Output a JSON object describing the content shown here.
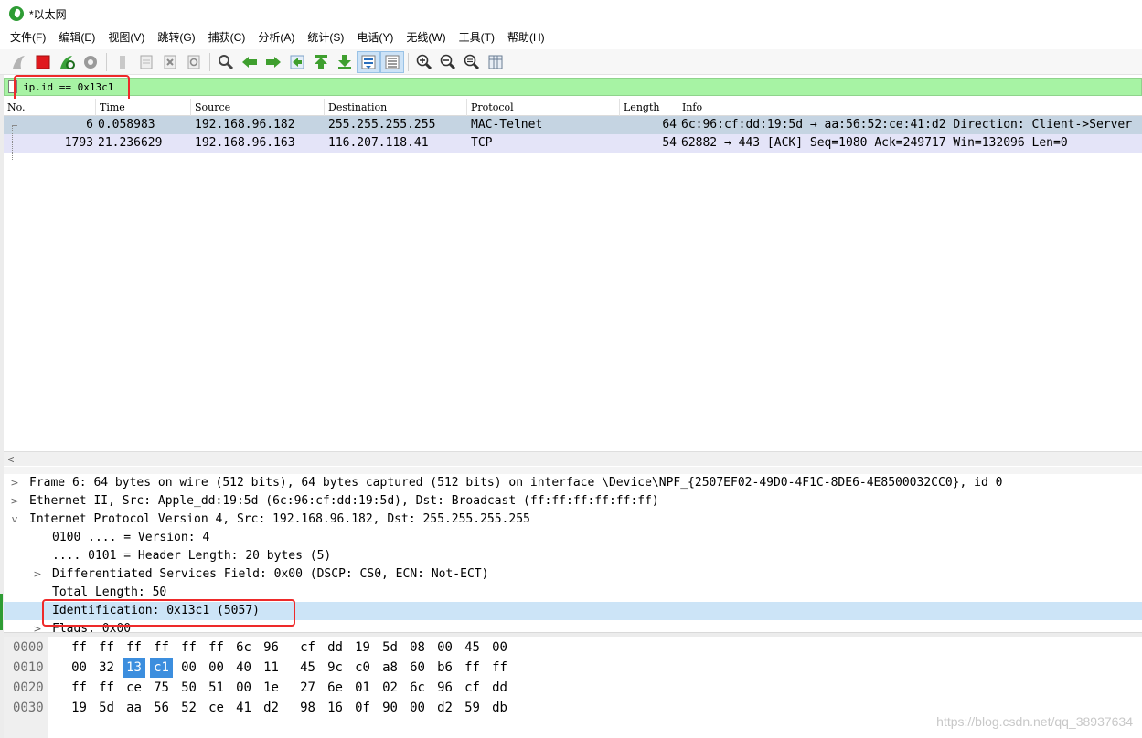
{
  "window": {
    "title": "*以太网"
  },
  "menu": [
    "文件(F)",
    "编辑(E)",
    "视图(V)",
    "跳转(G)",
    "捕获(C)",
    "分析(A)",
    "统计(S)",
    "电话(Y)",
    "无线(W)",
    "工具(T)",
    "帮助(H)"
  ],
  "toolbar": {
    "icons": [
      "shark-fin-start-icon",
      "stop-capture-icon",
      "restart-capture-icon",
      "capture-options-icon",
      "open-file-icon",
      "save-file-icon",
      "close-file-icon",
      "reload-file-icon",
      "find-packet-icon",
      "go-back-icon",
      "go-forward-icon",
      "go-to-packet-icon",
      "go-first-icon",
      "go-last-icon",
      "autoscroll-icon",
      "colorize-icon",
      "zoom-in-icon",
      "zoom-out-icon",
      "zoom-normal-icon",
      "resize-columns-icon"
    ]
  },
  "filter": {
    "value": "ip.id == 0x13c1"
  },
  "packet_list": {
    "columns": [
      "No.",
      "Time",
      "Source",
      "Destination",
      "Protocol",
      "Length",
      "Info"
    ],
    "rows": [
      {
        "no": "6",
        "time": "0.058983",
        "source": "192.168.96.182",
        "destination": "255.255.255.255",
        "protocol": "MAC-Telnet",
        "length": "64",
        "info": "6c:96:cf:dd:19:5d → aa:56:52:ce:41:d2 Direction: Client->Server"
      },
      {
        "no": "1793",
        "time": "21.236629",
        "source": "192.168.96.163",
        "destination": "116.207.118.41",
        "protocol": "TCP",
        "length": "54",
        "info": "62882 → 443 [ACK] Seq=1080 Ack=249717 Win=132096 Len=0"
      }
    ]
  },
  "details": {
    "rows": [
      {
        "exp": ">",
        "text": "Frame 6: 64 bytes on wire (512 bits), 64 bytes captured (512 bits) on interface \\Device\\NPF_{2507EF02-49D0-4F1C-8DE6-4E8500032CC0}, id 0"
      },
      {
        "exp": ">",
        "text": "Ethernet II, Src: Apple_dd:19:5d (6c:96:cf:dd:19:5d), Dst: Broadcast (ff:ff:ff:ff:ff:ff)"
      },
      {
        "exp": "v",
        "text": "Internet Protocol Version 4, Src: 192.168.96.182, Dst: 255.255.255.255"
      },
      {
        "exp": "",
        "text": "0100 .... = Version: 4"
      },
      {
        "exp": "",
        "text": ".... 0101 = Header Length: 20 bytes (5)"
      },
      {
        "exp": ">",
        "text": "Differentiated Services Field: 0x00 (DSCP: CS0, ECN: Not-ECT)"
      },
      {
        "exp": "",
        "text": "Total Length: 50"
      },
      {
        "exp": "",
        "text": "Identification: 0x13c1 (5057)"
      },
      {
        "exp": ">",
        "text": "Flags: 0x00"
      }
    ]
  },
  "bytes": {
    "rows": [
      {
        "offset": "0000",
        "hex": [
          "ff",
          "ff",
          "ff",
          "ff",
          "ff",
          "ff",
          "6c",
          "96",
          "cf",
          "dd",
          "19",
          "5d",
          "08",
          "00",
          "45",
          "00"
        ]
      },
      {
        "offset": "0010",
        "hex": [
          "00",
          "32",
          "13",
          "c1",
          "00",
          "00",
          "40",
          "11",
          "45",
          "9c",
          "c0",
          "a8",
          "60",
          "b6",
          "ff",
          "ff"
        ]
      },
      {
        "offset": "0020",
        "hex": [
          "ff",
          "ff",
          "ce",
          "75",
          "50",
          "51",
          "00",
          "1e",
          "27",
          "6e",
          "01",
          "02",
          "6c",
          "96",
          "cf",
          "dd"
        ]
      },
      {
        "offset": "0030",
        "hex": [
          "19",
          "5d",
          "aa",
          "56",
          "52",
          "ce",
          "41",
          "d2",
          "98",
          "16",
          "0f",
          "90",
          "00",
          "d2",
          "59",
          "db"
        ]
      }
    ]
  },
  "watermark": "https://blog.csdn.net/qq_38937634"
}
